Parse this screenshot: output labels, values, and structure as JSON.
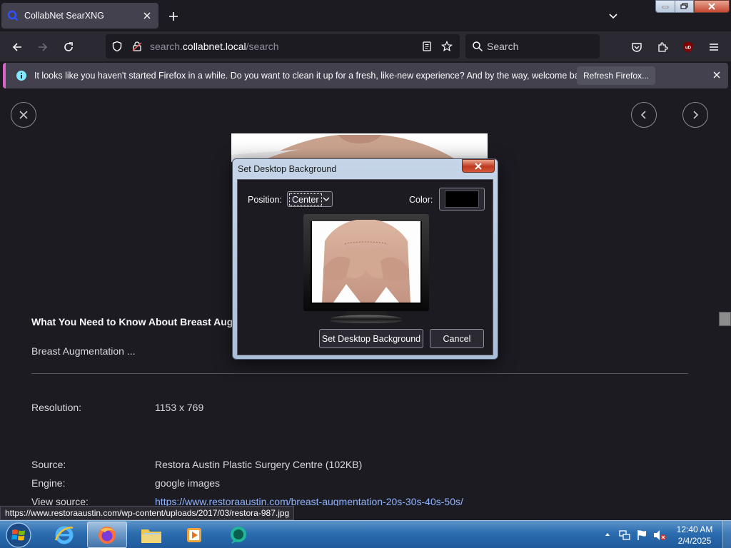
{
  "browser": {
    "tab_title": "CollabNet SearXNG",
    "url_path": "search.",
    "url_host": "collabnet.local",
    "url_rest": "/search",
    "search_placeholder": "Search",
    "notification": "It looks like you haven't started Firefox in a while. Do you want to clean it up for a fresh, like-new experience? And by the way, welcome back!",
    "refresh_button": "Refresh Firefox...",
    "ublock_badge": "uD",
    "status_url": "https://www.restoraaustin.com/wp-content/uploads/2017/03/restora-987.jpg"
  },
  "result": {
    "title": "What You Need to Know About Breast Augm",
    "description": "Breast Augmentation ...",
    "fields": [
      {
        "label": "Resolution:",
        "value": "1153 x 769"
      },
      {
        "label": "Source:",
        "value": "Restora Austin Plastic Surgery Centre (102KB)"
      },
      {
        "label": "Engine:",
        "value": "google images"
      },
      {
        "label": "View source:",
        "value": "https://www.restoraaustin.com/breast-augmentation-20s-30s-40s-50s/"
      }
    ]
  },
  "dialog": {
    "title": "Set Desktop Background",
    "position_label": "Position:",
    "position_value": "Center",
    "color_label": "Color:",
    "color_value": "#000000",
    "set_button": "Set Desktop Background",
    "cancel_button": "Cancel"
  },
  "taskbar": {
    "time": "12:40 AM",
    "date": "2/4/2025",
    "apps": [
      "internet-explorer",
      "firefox",
      "file-explorer",
      "media-player",
      "chat-app"
    ]
  },
  "colors": {
    "accent_link": "#8fb4ff",
    "notif_accent": "#d864c8",
    "page_bg": "#1c1b22"
  }
}
